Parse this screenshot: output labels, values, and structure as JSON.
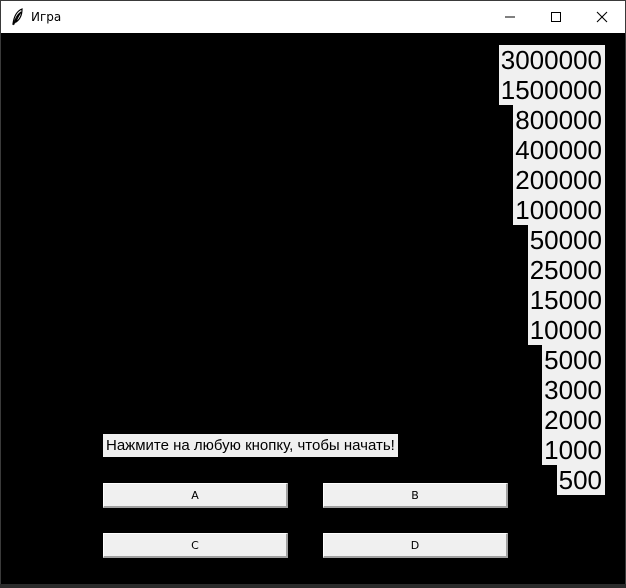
{
  "window": {
    "title": "Игра",
    "icon": "feather-icon",
    "controls": [
      "minimize-icon",
      "maximize-icon",
      "close-icon"
    ]
  },
  "prizes": [
    "3000000",
    "1500000",
    "800000",
    "400000",
    "200000",
    "100000",
    "50000",
    "25000",
    "15000",
    "10000",
    "5000",
    "3000",
    "2000",
    "1000",
    "500"
  ],
  "status_text": "Нажмите на любую кнопку, чтобы начать!",
  "answers": {
    "a": "A",
    "b": "B",
    "c": "C",
    "d": "D"
  },
  "colors": {
    "background": "#000000",
    "panel": "#f0f0f0",
    "text": "#000000"
  }
}
